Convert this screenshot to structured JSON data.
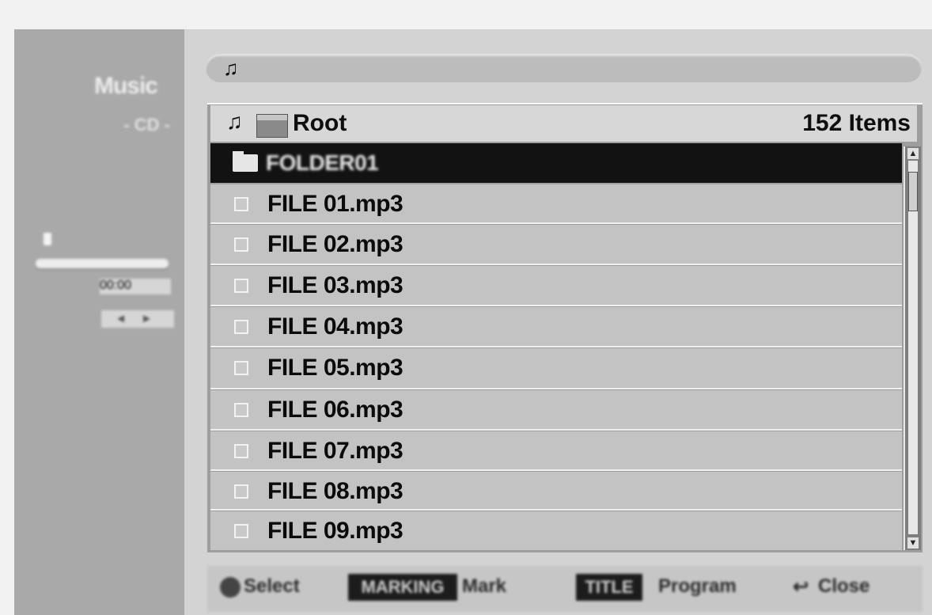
{
  "sidebar": {
    "title": "Music",
    "subtitle": "- CD -",
    "time": "00:00",
    "nav": "◂ ▸"
  },
  "topbar": {
    "icon": "music-note-icon"
  },
  "list": {
    "header": {
      "title": "Root",
      "count": "152 Items"
    },
    "selected_folder": "FOLDER01",
    "files": [
      "FILE 01.mp3",
      "FILE 02.mp3",
      "FILE 03.mp3",
      "FILE 04.mp3",
      "FILE 05.mp3",
      "FILE 06.mp3",
      "FILE 07.mp3",
      "FILE 08.mp3",
      "FILE 09.mp3"
    ]
  },
  "footer": {
    "select_label": "Select",
    "key_marking": "MARKING",
    "mark_label": "Mark",
    "key_title": "TITLE",
    "program_label": "Program",
    "close_label": "Close"
  },
  "colors": {
    "sidebar_bg": "#a9a9a9",
    "row_bg": "#c3c3c3",
    "selected_bg": "#121212"
  }
}
